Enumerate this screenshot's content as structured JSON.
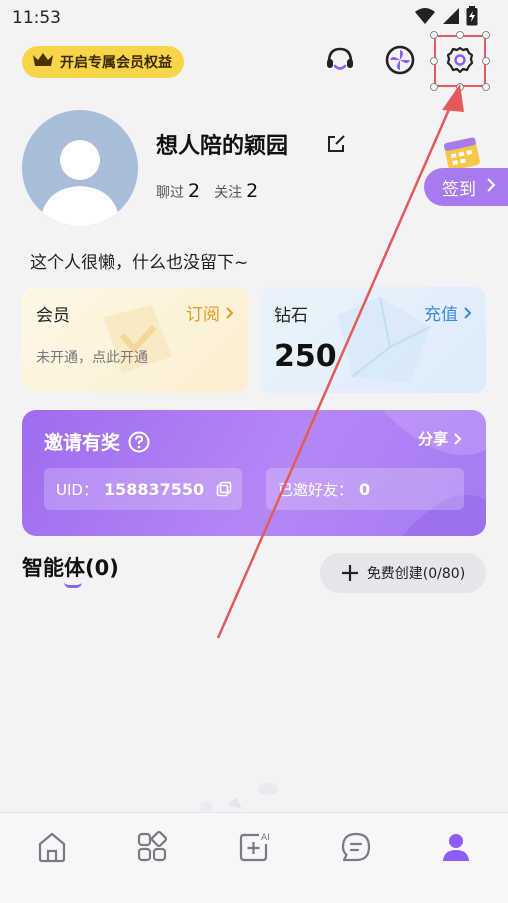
{
  "status_bar": {
    "time": "11:53"
  },
  "header": {
    "vip_banner": "开启专属会员权益",
    "icons": [
      "headset-icon",
      "pinwheel-icon",
      "gear-icon"
    ]
  },
  "profile": {
    "username": "想人陪的颖园",
    "stats": [
      {
        "label": "聊过",
        "value": "2"
      },
      {
        "label": "关注",
        "value": "2"
      }
    ],
    "bio": "这个人很懒，什么也没留下~",
    "signin_label": "签到"
  },
  "cards": {
    "vip": {
      "title": "会员",
      "action": "订阅",
      "status": "未开通，点此开通"
    },
    "diamond": {
      "title": "钻石",
      "action": "充值",
      "amount": "250"
    }
  },
  "invite": {
    "title": "邀请有奖",
    "share": "分享",
    "uid_label": "UID：",
    "uid_value": "158837550",
    "invited_label": "已邀好友：",
    "invited_count": "0"
  },
  "agents": {
    "title": "智能体(0)",
    "create_button": "免费创建(0/80)"
  },
  "bottom_nav": {
    "items": [
      "home-icon",
      "apps-icon",
      "ai-create-icon",
      "messages-icon",
      "profile-icon"
    ],
    "active_color": "#8b5cf6"
  },
  "colors": {
    "accent": "#a77af0",
    "vip_gold": "#f8d449",
    "annotation_red": "#e45a5a"
  }
}
